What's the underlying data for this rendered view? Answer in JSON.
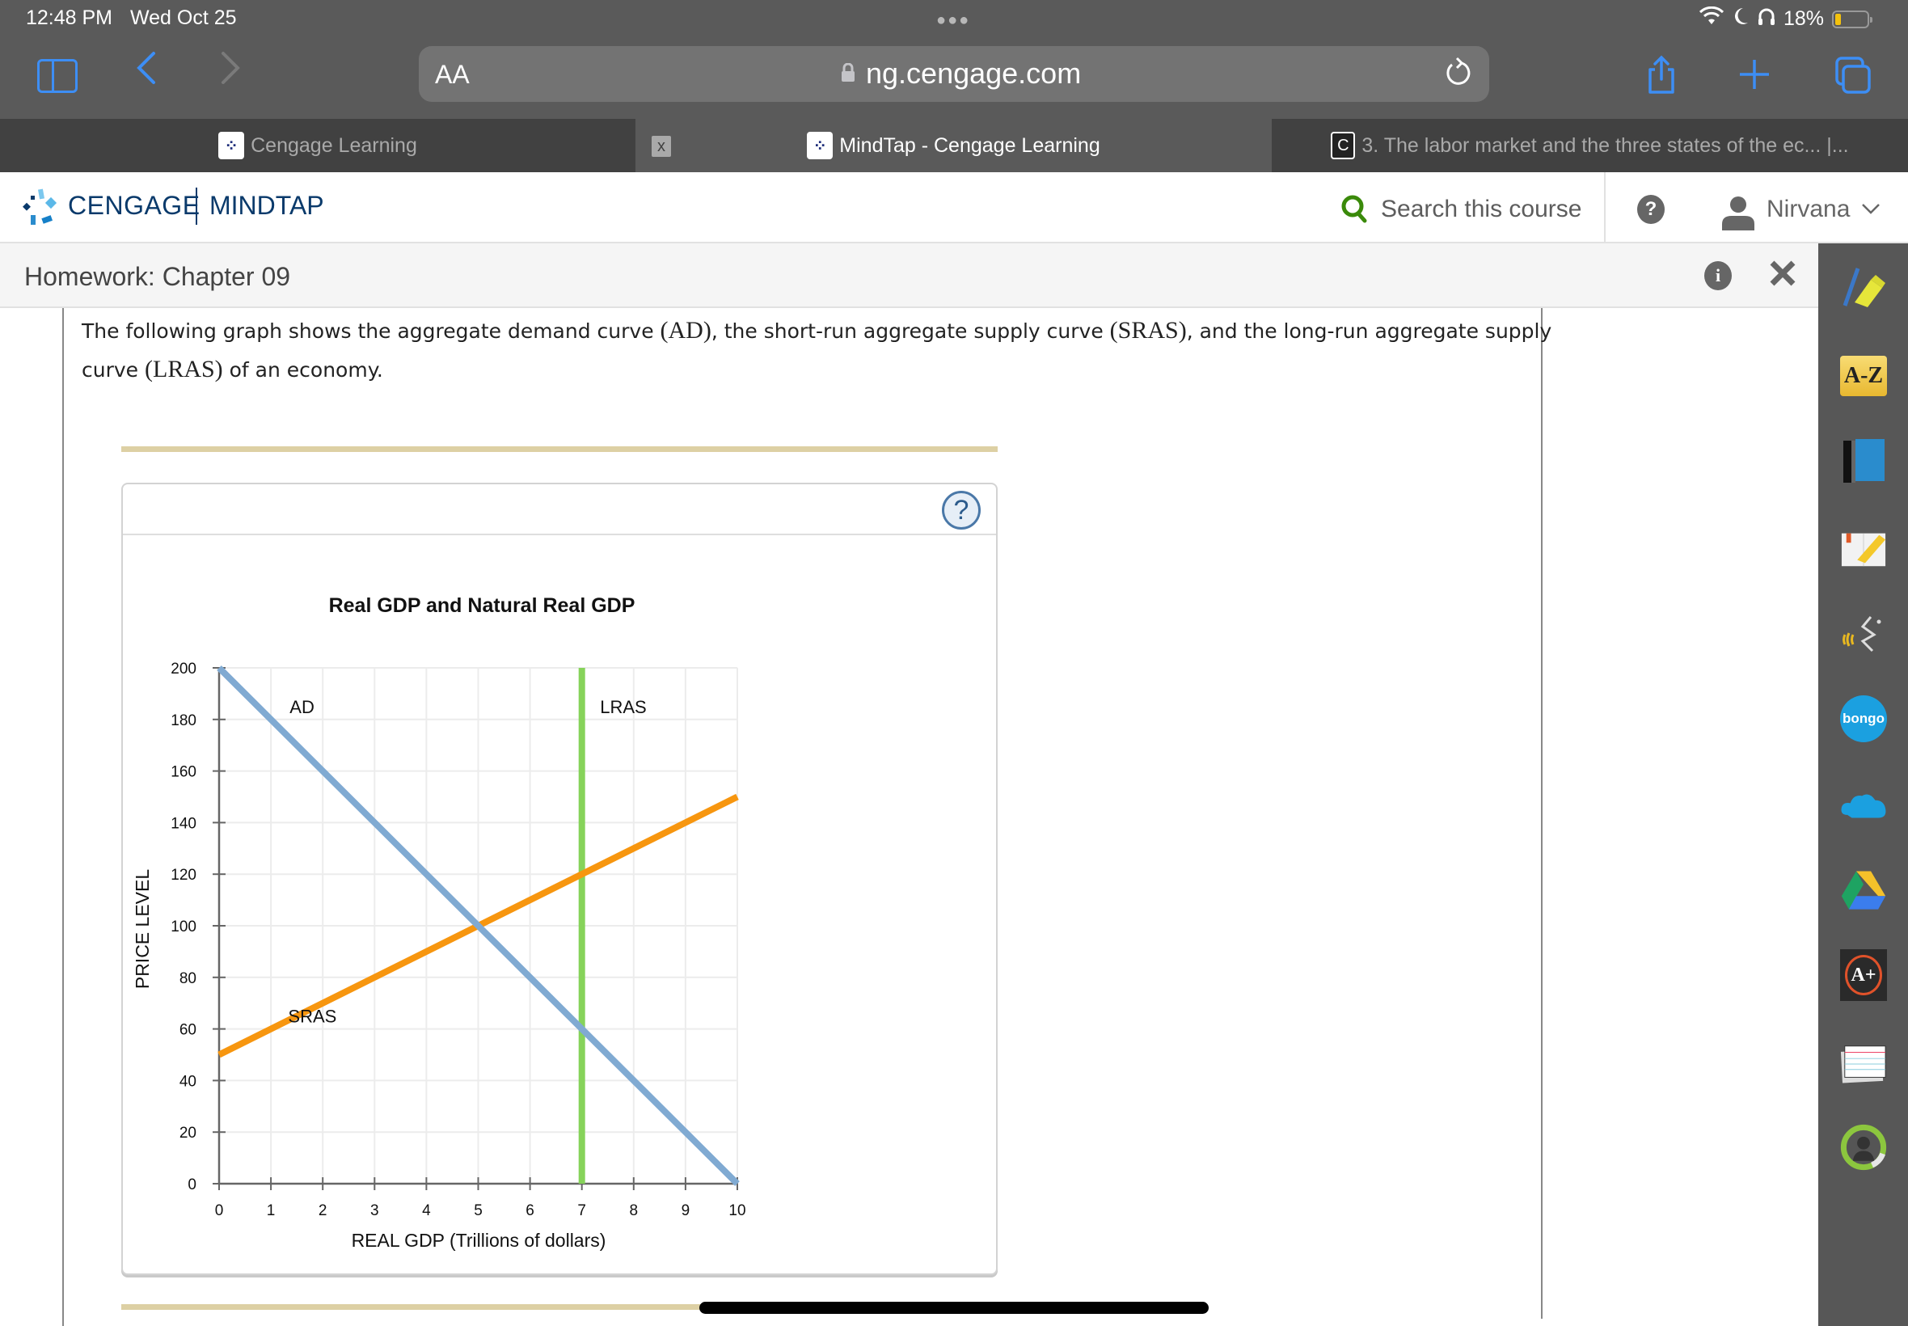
{
  "status_bar": {
    "time": "12:48 PM",
    "date": "Wed Oct 25",
    "battery": "18%",
    "battery_level": 0.18
  },
  "browser": {
    "text_size_label": "AA",
    "url": "ng.cengage.com",
    "tabs": [
      {
        "title": "Cengage Learning",
        "active": false
      },
      {
        "title": "MindTap - Cengage Learning",
        "active": true
      },
      {
        "title": "3. The labor market and the three states of the ec... |...",
        "active": false
      }
    ],
    "tab_close_label": "x",
    "favicon_c": "C"
  },
  "header": {
    "brand": "CENGAGE",
    "product": "MINDTAP",
    "search_placeholder": "Search this course",
    "help_label": "?",
    "user_name": "Nirvana"
  },
  "homework": {
    "title": "Homework: Chapter 09",
    "info_label": "i"
  },
  "question": {
    "line1_part1": "The following graph shows the aggregate demand curve ",
    "ad_abbr": "(AD)",
    "line1_part2": ", the short-run aggregate supply curve ",
    "sras_abbr": "(SRAS)",
    "line1_part3": ", and the long-run aggregate supply",
    "line2_part1": "curve ",
    "lras_abbr": "(LRAS)",
    "line2_part2": " of an economy."
  },
  "chart_help_label": "?",
  "tool_rail": [
    {
      "name": "highlighter-pen-icon"
    },
    {
      "name": "a-z-glossary-icon",
      "label": "A-Z"
    },
    {
      "name": "book-icon"
    },
    {
      "name": "notebook-highlighter-icon"
    },
    {
      "name": "read-speaker-icon"
    },
    {
      "name": "bongo-icon",
      "label": "bongo"
    },
    {
      "name": "onedrive-icon"
    },
    {
      "name": "google-drive-icon"
    },
    {
      "name": "aplus-icon",
      "label": "A+"
    },
    {
      "name": "flashcards-icon"
    },
    {
      "name": "progress-icon"
    }
  ],
  "chart_data": {
    "type": "line",
    "title": "Real GDP and Natural Real GDP",
    "xlabel": "REAL GDP (Trillions of dollars)",
    "ylabel": "PRICE LEVEL",
    "xlim": [
      0,
      10
    ],
    "ylim": [
      0,
      200
    ],
    "x_ticks": [
      0,
      1,
      2,
      3,
      4,
      5,
      6,
      7,
      8,
      9,
      10
    ],
    "y_ticks": [
      0,
      20,
      40,
      60,
      80,
      100,
      120,
      140,
      160,
      180,
      200
    ],
    "grid": true,
    "series": [
      {
        "name": "AD",
        "color": "#80aad2",
        "points": [
          [
            0,
            200
          ],
          [
            10,
            0
          ]
        ],
        "label_at": [
          1.6,
          185
        ]
      },
      {
        "name": "SRAS",
        "color": "#f7960f",
        "points": [
          [
            0,
            50
          ],
          [
            10,
            150
          ]
        ],
        "label_at": [
          1.8,
          65
        ]
      },
      {
        "name": "LRAS",
        "color": "#86d35a",
        "points": [
          [
            7,
            0
          ],
          [
            7,
            200
          ]
        ],
        "label_at": [
          7.8,
          185
        ]
      }
    ]
  }
}
